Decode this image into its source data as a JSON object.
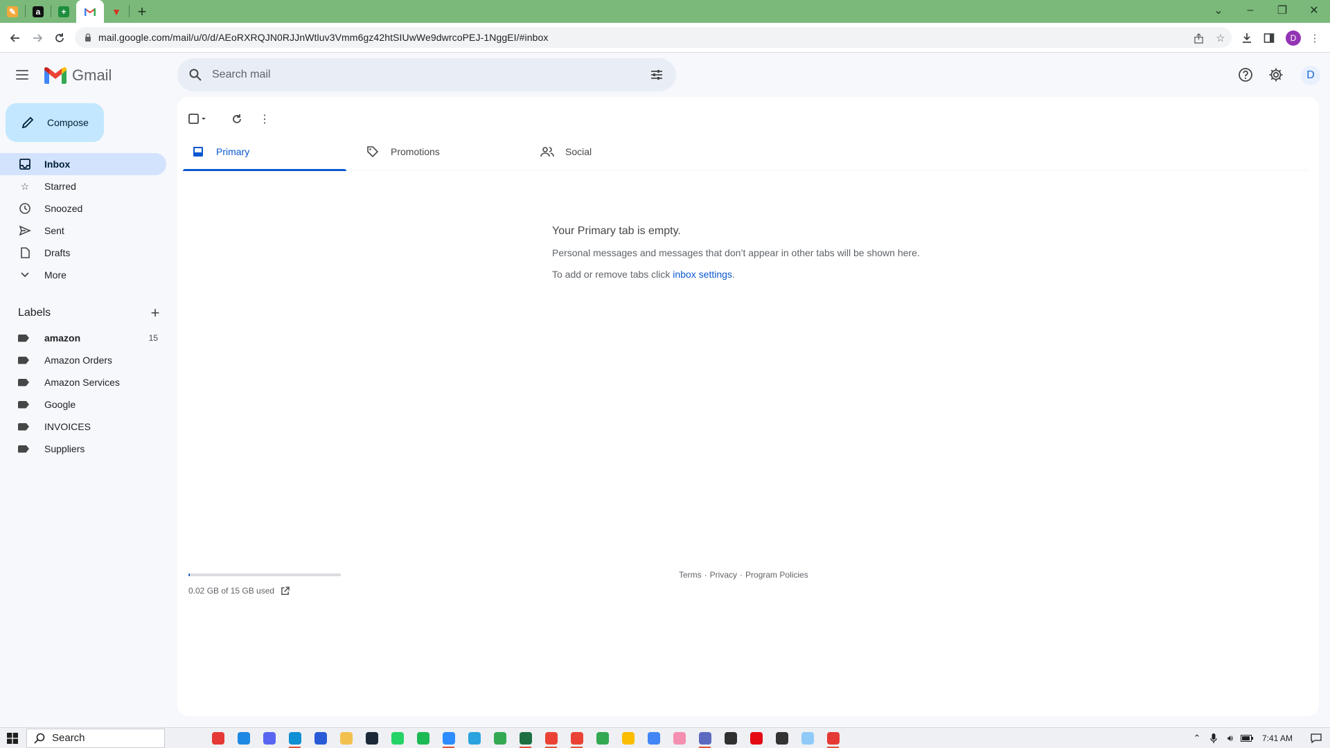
{
  "browser": {
    "tabs": [
      {
        "icon": "pencil-favicon-icon",
        "color": "#f2a93b",
        "glyph": "✎"
      },
      {
        "icon": "amazon-favicon-icon",
        "color": "#111111",
        "glyph": "a"
      },
      {
        "icon": "plus-app-favicon-icon",
        "color": "#1e8e3e",
        "glyph": "+"
      },
      {
        "icon": "gmail-favicon-icon",
        "color": "#ffffff",
        "glyph": "M"
      },
      {
        "icon": "red-v-favicon-icon",
        "color": "#d93025",
        "glyph": "▼"
      }
    ],
    "new_tab": "+",
    "url": "mail.google.com/mail/u/0/d/AEoRXRQJN0RJJnWtluv3Vmm6gz42htSIUwWe9dwrcoPEJ-1NggEI/#inbox",
    "profile_initial": "D"
  },
  "header": {
    "app_name": "Gmail",
    "search_placeholder": "Search mail",
    "avatar_initial": "D"
  },
  "sidebar": {
    "compose": "Compose",
    "items": [
      {
        "label": "Inbox",
        "icon": "inbox-icon",
        "active": true
      },
      {
        "label": "Starred",
        "icon": "star-icon"
      },
      {
        "label": "Snoozed",
        "icon": "clock-icon"
      },
      {
        "label": "Sent",
        "icon": "send-icon"
      },
      {
        "label": "Drafts",
        "icon": "draft-icon"
      },
      {
        "label": "More",
        "icon": "chevron-down-icon"
      }
    ],
    "labels_heading": "Labels",
    "labels": [
      {
        "label": "amazon",
        "count": "15",
        "bold": true
      },
      {
        "label": "Amazon Orders"
      },
      {
        "label": "Amazon Services"
      },
      {
        "label": "Google"
      },
      {
        "label": "INVOICES"
      },
      {
        "label": "Suppliers"
      }
    ]
  },
  "main": {
    "tabs": [
      {
        "label": "Primary",
        "icon": "inbox-tab-icon",
        "active": true
      },
      {
        "label": "Promotions",
        "icon": "tag-icon"
      },
      {
        "label": "Social",
        "icon": "people-icon"
      }
    ],
    "empty_title": "Your Primary tab is empty.",
    "empty_line1": "Personal messages and messages that don’t appear in other tabs will be shown here.",
    "empty_line2_prefix": "To add or remove tabs click ",
    "empty_line2_link": "inbox settings",
    "empty_line2_suffix": ".",
    "storage_text": "0.02 GB of 15 GB used",
    "storage_fraction": 0.0013,
    "footer": [
      "Terms",
      "·",
      "Privacy",
      "·",
      "Program Policies"
    ]
  },
  "taskbar": {
    "search_label": "Search",
    "apps": [
      {
        "name": "media-app-icon",
        "color": "#e53935"
      },
      {
        "name": "mail-app-icon",
        "color": "#1e88e5"
      },
      {
        "name": "discord-app-icon",
        "color": "#5865f2"
      },
      {
        "name": "edge-app-icon",
        "color": "#0f8fd4",
        "open": true
      },
      {
        "name": "store-app-icon",
        "color": "#2a5bd7"
      },
      {
        "name": "file-explorer-app-icon",
        "color": "#f2c14e"
      },
      {
        "name": "steam-app-icon",
        "color": "#1b2838"
      },
      {
        "name": "whatsapp-app-icon",
        "color": "#25d366"
      },
      {
        "name": "spotify-app-icon",
        "color": "#1db954"
      },
      {
        "name": "zoom-app-icon",
        "color": "#2d8cff",
        "open": true
      },
      {
        "name": "telegram-app-icon",
        "color": "#2aa3df"
      },
      {
        "name": "chrome-app-icon",
        "color": "#34a853"
      },
      {
        "name": "excel-app-icon",
        "color": "#1d6f42",
        "open": true
      },
      {
        "name": "chrome-profile-2-app-icon",
        "color": "#ea4335",
        "open": true
      },
      {
        "name": "chrome-profile-3-app-icon",
        "color": "#ea4335",
        "open": true
      },
      {
        "name": "chrome-profile-4-app-icon",
        "color": "#34a853"
      },
      {
        "name": "chrome-profile-5-app-icon",
        "color": "#fbbc04"
      },
      {
        "name": "chrome-profile-6-app-icon",
        "color": "#4285f4"
      },
      {
        "name": "paint-app-icon",
        "color": "#f48fb1"
      },
      {
        "name": "calculator-app-icon",
        "color": "#5c6bc0",
        "open": true
      },
      {
        "name": "obs-app-icon",
        "color": "#303030"
      },
      {
        "name": "netflix-app-icon",
        "color": "#e50914"
      },
      {
        "name": "terminal-app-icon",
        "color": "#333333"
      },
      {
        "name": "notepad-app-icon",
        "color": "#90caf9"
      },
      {
        "name": "pdf-app-icon",
        "color": "#e53935",
        "open": true
      }
    ],
    "time": "7:41 AM"
  }
}
